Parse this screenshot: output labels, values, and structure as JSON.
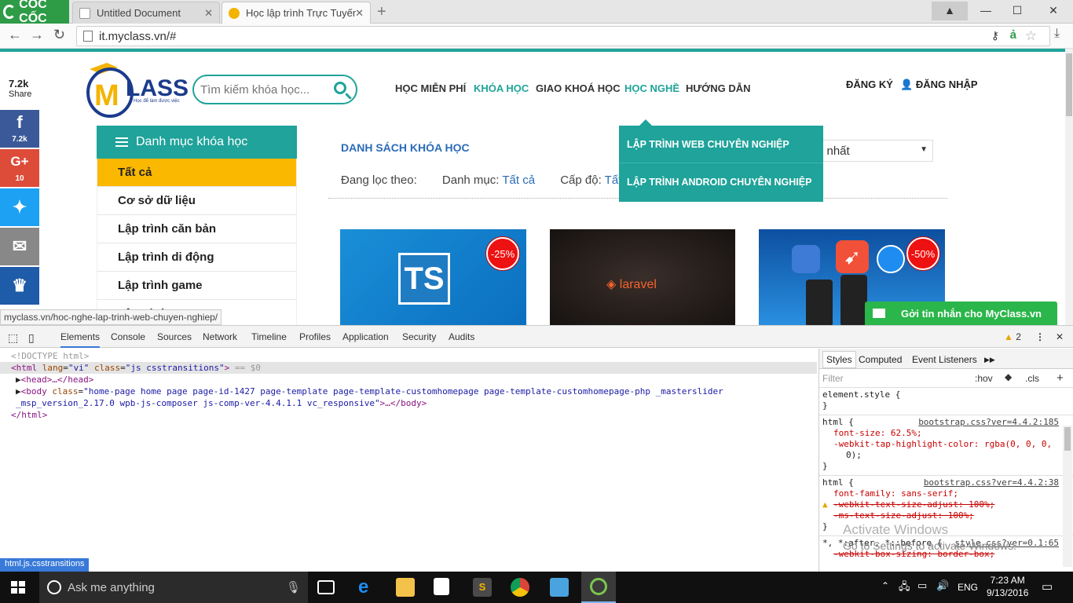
{
  "browser": {
    "brand": "CỐC CỐC",
    "tabs": [
      {
        "title": "Untitled Document"
      },
      {
        "title": "Học lập trình Trực Tuyến |"
      }
    ],
    "window_controls": {
      "minimize": "—",
      "maximize": "☐",
      "close": "✕"
    },
    "url": "it.myclass.vn/#",
    "status_url": "myclass.vn/hoc-nghe-lap-trinh-web-chuyen-nghiep/"
  },
  "page": {
    "share": {
      "count": "7.2k",
      "label": "Share",
      "facebook_count": "7.2k",
      "gplus_count": "10"
    },
    "brand_text": "LASS",
    "brand_tagline": "Học để làm được việc",
    "search": {
      "placeholder": "Tìm kiếm khóa học..."
    },
    "nav": [
      "HỌC MIỄN PHÍ",
      "KHÓA HỌC",
      "GIAO KHOÁ HỌC",
      "HỌC NGHỀ",
      "HƯỚNG DẪN"
    ],
    "account": {
      "register": "ĐĂNG KÝ",
      "login": "ĐĂNG NHẬP"
    },
    "sidebar": {
      "title": "Danh mục khóa học",
      "items": [
        "Tất cả",
        "Cơ sở dữ liệu",
        "Lập trình căn bản",
        "Lập trình di động",
        "Lập trình game",
        "Lập trình ..."
      ]
    },
    "list_title": "DANH SÁCH KHÓA HỌC",
    "filters": {
      "label": "Đang lọc theo:",
      "category_label": "Danh mục:",
      "category_value": "Tất cả",
      "level_label": "Cấp độ:",
      "level_value": "Tất c"
    },
    "sort_value": "i nhất",
    "dropdown": [
      "LẬP TRÌNH WEB CHUYÊN NGHIỆP",
      "LẬP TRÌNH ANDROID CHUYÊN NGHIỆP"
    ],
    "cards": [
      {
        "logo": "TS",
        "discount": "-25%"
      },
      {
        "logo": "laravel",
        "discount": ""
      },
      {
        "logo": "",
        "discount": "-50%"
      }
    ],
    "chat_button": "Gởi tin nhắn cho MyClass.vn"
  },
  "devtools": {
    "tabs": [
      "Elements",
      "Console",
      "Sources",
      "Network",
      "Timeline",
      "Profiles",
      "Application",
      "Security",
      "Audits"
    ],
    "warning_count": "2",
    "dom": {
      "doctype": "<!DOCTYPE html>",
      "html_open_tag": "html",
      "html_attr1": "lang",
      "html_val1": "\"vi\"",
      "html_attr2": "class",
      "html_val2": "\"js csstransitions\"",
      "html_sel": "== $0",
      "head": "<head>…</head>",
      "body_attr": "class",
      "body_val": "\"home-page home page page-id-1427 page-template page-template-customhomepage page-template-customhomepage-php _masterslider _msp_version_2.17.0 wpb-js-composer js-comp-ver-4.4.1.1 vc_responsive\"",
      "body_close": "…</body>",
      "html_close": "</html>"
    },
    "styles_tabs": [
      "Styles",
      "Computed",
      "Event Listeners"
    ],
    "filter_placeholder": "Filter",
    "hov": ":hov",
    "cls": ".cls",
    "rules": [
      {
        "selector": "element.style {",
        "src": "",
        "props": [],
        "close": "}"
      },
      {
        "selector": "html {",
        "src": "bootstrap.css?ver=4.4.2:185",
        "props": [
          "font-size: 62.5%;",
          "-webkit-tap-highlight-color: rgba(0, 0, 0,",
          "  0);"
        ],
        "close": "}"
      },
      {
        "selector": "html {",
        "src": "bootstrap.css?ver=4.4.2:38",
        "props": [
          "font-family: sans-serif;",
          "-webkit-text-size-adjust: 100%;",
          "-ms-text-size-adjust: 100%;"
        ],
        "close": "}"
      },
      {
        "selector": "*, *:after, *::before {",
        "src": "style.css?ver=0.1:65",
        "props": [
          "-webkit-box-sizing: border-box;"
        ],
        "close": ""
      }
    ],
    "breadcrumb": "html.js.csstransitions",
    "activate": [
      "Activate Windows",
      "Go to Settings to activate Windows."
    ]
  },
  "taskbar": {
    "search_placeholder": "Ask me anything",
    "language": "ENG",
    "time": "7:23 AM",
    "date": "9/13/2016"
  },
  "colors": {
    "teal": "#1fa39a",
    "yellow": "#fbb800",
    "facebook": "#3b5998",
    "gplus": "#dd4b39",
    "twitter": "#1da1f2",
    "email": "#888888",
    "crown": "#1e5ba8",
    "chat": "#2ab64a"
  }
}
